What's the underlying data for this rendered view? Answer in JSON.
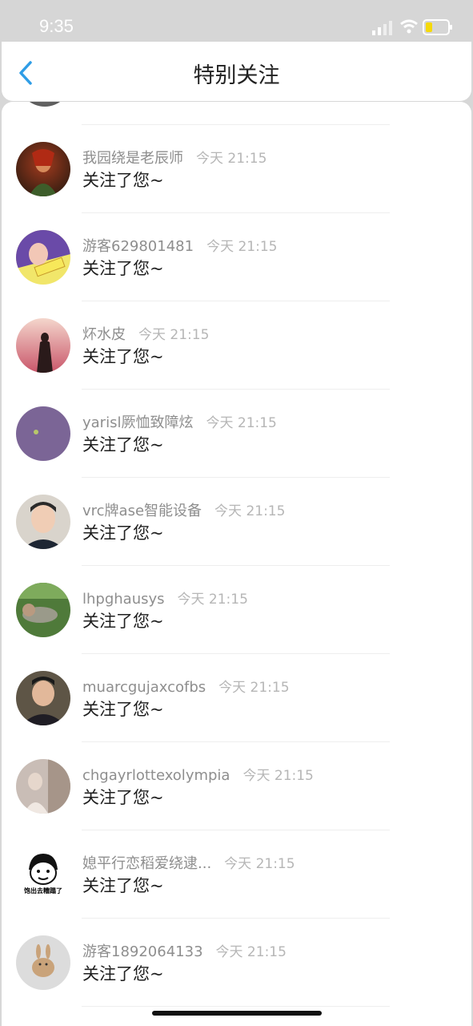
{
  "status_bar": {
    "time": "9:35"
  },
  "header": {
    "title": "特别关注"
  },
  "items": [
    {
      "name": "我园绕是老辰师",
      "time": "今天 21:15",
      "action": "关注了您~"
    },
    {
      "name": "游客629801481",
      "time": "今天 21:15",
      "action": "关注了您~"
    },
    {
      "name": "炋水皮",
      "time": "今天 21:15",
      "action": "关注了您~"
    },
    {
      "name": "yarisl厥恤致障炫",
      "time": "今天 21:15",
      "action": "关注了您~"
    },
    {
      "name": "vrc牌ase智能设备",
      "time": "今天 21:15",
      "action": "关注了您~"
    },
    {
      "name": "lhpghausys",
      "time": "今天 21:15",
      "action": "关注了您~"
    },
    {
      "name": "muarcgujaxcofbs",
      "time": "今天 21:15",
      "action": "关注了您~"
    },
    {
      "name": "chgayrlottexolympia",
      "time": "今天 21:15",
      "action": "关注了您~"
    },
    {
      "name": "媳平行恋稻爱绕逮...",
      "time": "今天 21:15",
      "action": "关注了您~",
      "avatar_caption": "饱出去糟蹋了"
    },
    {
      "name": "游客1892064133",
      "time": "今天 21:15",
      "action": "关注了您~"
    }
  ]
}
